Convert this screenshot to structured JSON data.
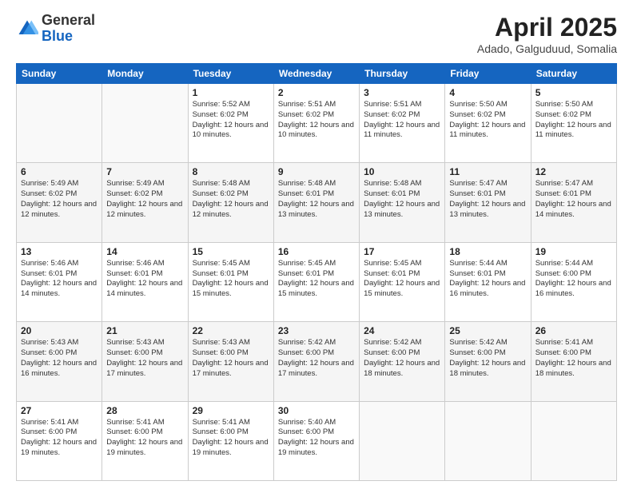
{
  "header": {
    "logo_general": "General",
    "logo_blue": "Blue",
    "title": "April 2025",
    "location": "Adado, Galguduud, Somalia"
  },
  "weekdays": [
    "Sunday",
    "Monday",
    "Tuesday",
    "Wednesday",
    "Thursday",
    "Friday",
    "Saturday"
  ],
  "weeks": [
    [
      {
        "day": "",
        "info": ""
      },
      {
        "day": "",
        "info": ""
      },
      {
        "day": "1",
        "info": "Sunrise: 5:52 AM\nSunset: 6:02 PM\nDaylight: 12 hours and 10 minutes."
      },
      {
        "day": "2",
        "info": "Sunrise: 5:51 AM\nSunset: 6:02 PM\nDaylight: 12 hours and 10 minutes."
      },
      {
        "day": "3",
        "info": "Sunrise: 5:51 AM\nSunset: 6:02 PM\nDaylight: 12 hours and 11 minutes."
      },
      {
        "day": "4",
        "info": "Sunrise: 5:50 AM\nSunset: 6:02 PM\nDaylight: 12 hours and 11 minutes."
      },
      {
        "day": "5",
        "info": "Sunrise: 5:50 AM\nSunset: 6:02 PM\nDaylight: 12 hours and 11 minutes."
      }
    ],
    [
      {
        "day": "6",
        "info": "Sunrise: 5:49 AM\nSunset: 6:02 PM\nDaylight: 12 hours and 12 minutes."
      },
      {
        "day": "7",
        "info": "Sunrise: 5:49 AM\nSunset: 6:02 PM\nDaylight: 12 hours and 12 minutes."
      },
      {
        "day": "8",
        "info": "Sunrise: 5:48 AM\nSunset: 6:02 PM\nDaylight: 12 hours and 12 minutes."
      },
      {
        "day": "9",
        "info": "Sunrise: 5:48 AM\nSunset: 6:01 PM\nDaylight: 12 hours and 13 minutes."
      },
      {
        "day": "10",
        "info": "Sunrise: 5:48 AM\nSunset: 6:01 PM\nDaylight: 12 hours and 13 minutes."
      },
      {
        "day": "11",
        "info": "Sunrise: 5:47 AM\nSunset: 6:01 PM\nDaylight: 12 hours and 13 minutes."
      },
      {
        "day": "12",
        "info": "Sunrise: 5:47 AM\nSunset: 6:01 PM\nDaylight: 12 hours and 14 minutes."
      }
    ],
    [
      {
        "day": "13",
        "info": "Sunrise: 5:46 AM\nSunset: 6:01 PM\nDaylight: 12 hours and 14 minutes."
      },
      {
        "day": "14",
        "info": "Sunrise: 5:46 AM\nSunset: 6:01 PM\nDaylight: 12 hours and 14 minutes."
      },
      {
        "day": "15",
        "info": "Sunrise: 5:45 AM\nSunset: 6:01 PM\nDaylight: 12 hours and 15 minutes."
      },
      {
        "day": "16",
        "info": "Sunrise: 5:45 AM\nSunset: 6:01 PM\nDaylight: 12 hours and 15 minutes."
      },
      {
        "day": "17",
        "info": "Sunrise: 5:45 AM\nSunset: 6:01 PM\nDaylight: 12 hours and 15 minutes."
      },
      {
        "day": "18",
        "info": "Sunrise: 5:44 AM\nSunset: 6:01 PM\nDaylight: 12 hours and 16 minutes."
      },
      {
        "day": "19",
        "info": "Sunrise: 5:44 AM\nSunset: 6:00 PM\nDaylight: 12 hours and 16 minutes."
      }
    ],
    [
      {
        "day": "20",
        "info": "Sunrise: 5:43 AM\nSunset: 6:00 PM\nDaylight: 12 hours and 16 minutes."
      },
      {
        "day": "21",
        "info": "Sunrise: 5:43 AM\nSunset: 6:00 PM\nDaylight: 12 hours and 17 minutes."
      },
      {
        "day": "22",
        "info": "Sunrise: 5:43 AM\nSunset: 6:00 PM\nDaylight: 12 hours and 17 minutes."
      },
      {
        "day": "23",
        "info": "Sunrise: 5:42 AM\nSunset: 6:00 PM\nDaylight: 12 hours and 17 minutes."
      },
      {
        "day": "24",
        "info": "Sunrise: 5:42 AM\nSunset: 6:00 PM\nDaylight: 12 hours and 18 minutes."
      },
      {
        "day": "25",
        "info": "Sunrise: 5:42 AM\nSunset: 6:00 PM\nDaylight: 12 hours and 18 minutes."
      },
      {
        "day": "26",
        "info": "Sunrise: 5:41 AM\nSunset: 6:00 PM\nDaylight: 12 hours and 18 minutes."
      }
    ],
    [
      {
        "day": "27",
        "info": "Sunrise: 5:41 AM\nSunset: 6:00 PM\nDaylight: 12 hours and 19 minutes."
      },
      {
        "day": "28",
        "info": "Sunrise: 5:41 AM\nSunset: 6:00 PM\nDaylight: 12 hours and 19 minutes."
      },
      {
        "day": "29",
        "info": "Sunrise: 5:41 AM\nSunset: 6:00 PM\nDaylight: 12 hours and 19 minutes."
      },
      {
        "day": "30",
        "info": "Sunrise: 5:40 AM\nSunset: 6:00 PM\nDaylight: 12 hours and 19 minutes."
      },
      {
        "day": "",
        "info": ""
      },
      {
        "day": "",
        "info": ""
      },
      {
        "day": "",
        "info": ""
      }
    ]
  ]
}
